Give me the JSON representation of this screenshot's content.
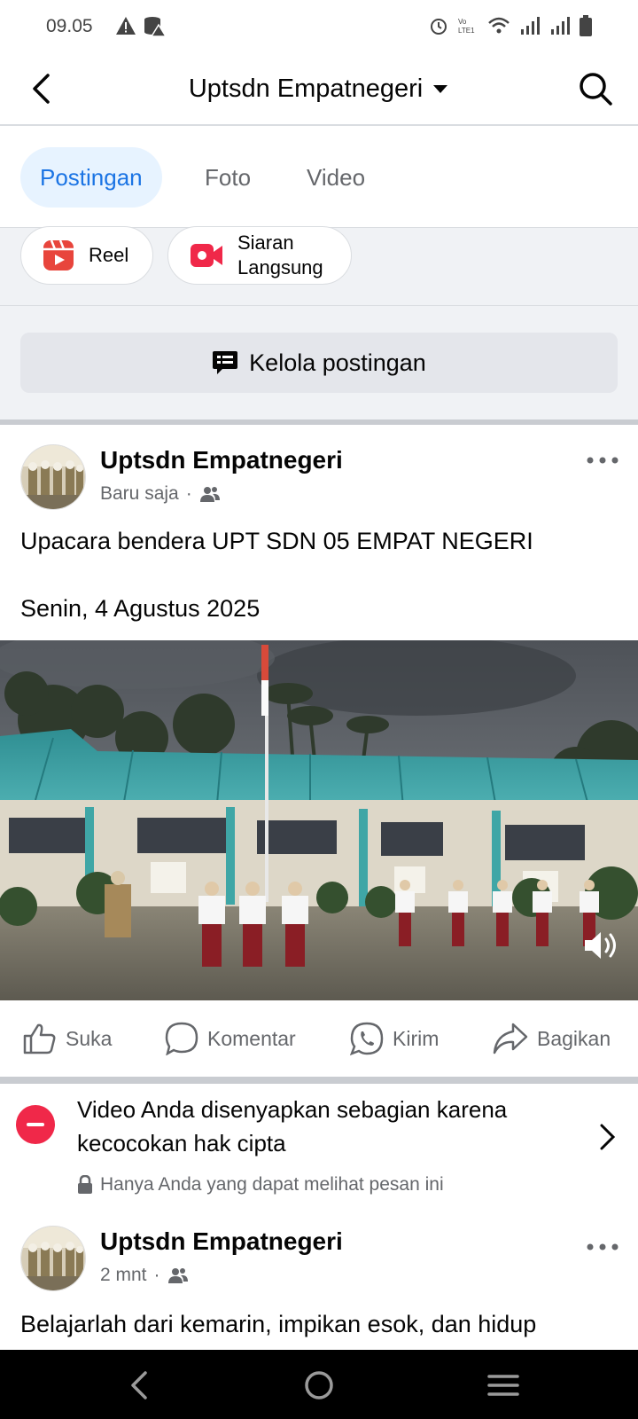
{
  "status_bar": {
    "time": "09.05"
  },
  "header": {
    "title": "Uptsdn Empatnegeri"
  },
  "tabs": [
    {
      "label": "Postingan",
      "active": true
    },
    {
      "label": "Foto",
      "active": false
    },
    {
      "label": "Video",
      "active": false
    }
  ],
  "create": {
    "reel_label": "Reel",
    "live_label_line1": "Siaran",
    "live_label_line2": "Langsung"
  },
  "manage": {
    "label": "Kelola postingan"
  },
  "post1": {
    "author": "Uptsdn Empatnegeri",
    "time": "Baru saja",
    "text_line1": "Upacara bendera UPT SDN 05 EMPAT NEGERI",
    "text_line2": "Senin, 4 Agustus 2025"
  },
  "actions": {
    "like": "Suka",
    "comment": "Komentar",
    "send": "Kirim",
    "share": "Bagikan"
  },
  "notice": {
    "text": "Video Anda disenyapkan sebagian karena kecocokan hak cipta",
    "sub": "Hanya Anda yang dapat melihat pesan ini"
  },
  "post2": {
    "author": "Uptsdn Empatnegeri",
    "time": "2 mnt",
    "text": "Belajarlah dari kemarin, impikan esok, dan hidup"
  },
  "colors": {
    "accent": "#1b74e4",
    "tab_active_bg": "#e7f3ff",
    "red": "#f02849",
    "reel_red": "#e8453c"
  }
}
